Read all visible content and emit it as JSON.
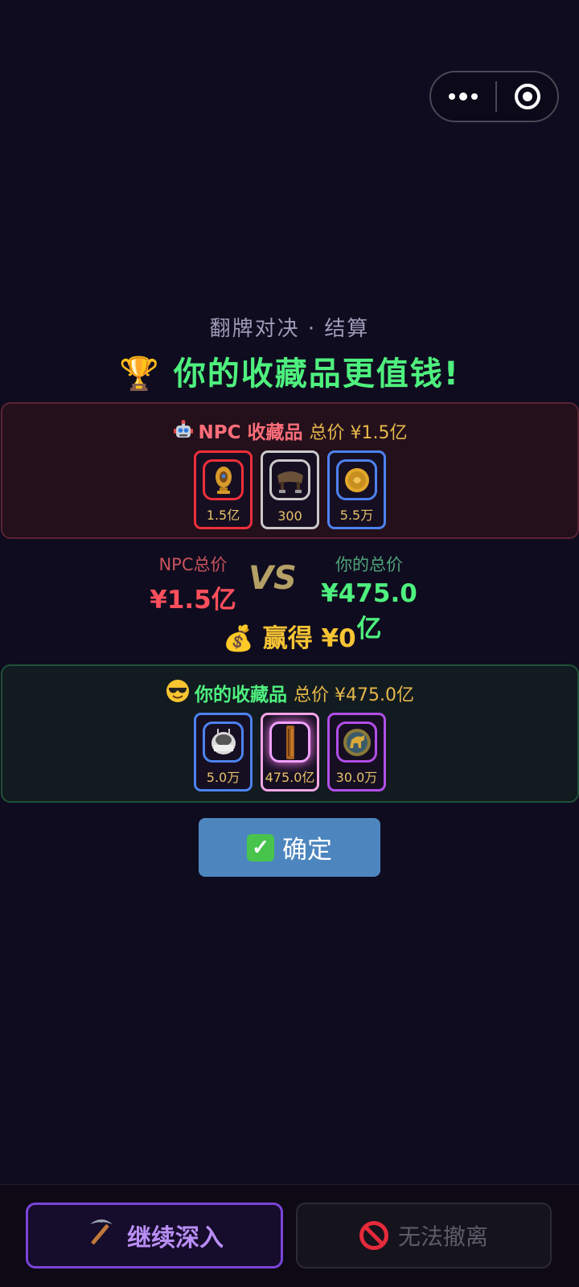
{
  "header": {
    "subtitle": "翻牌对决 · 结算",
    "headline_icon": "trophy-icon",
    "headline": "🏆 你的收藏品更值钱!"
  },
  "npc_panel": {
    "icon": "robot-icon",
    "title": "NPC 收藏品",
    "total": "总价 ¥1.5亿",
    "items": [
      {
        "icon": "golden-egg-icon",
        "value": "1.5亿",
        "rarity_color": "#ef2f3a"
      },
      {
        "icon": "saddle-icon",
        "value": "300",
        "rarity_color": "#c9c9c9"
      },
      {
        "icon": "gold-coin-icon",
        "value": "5.5万",
        "rarity_color": "#4d82f0"
      }
    ]
  },
  "versus": {
    "npc_label": "NPC总价",
    "npc_amount": "¥1.5亿",
    "vs": "VS",
    "you_label": "你的总价",
    "you_amount": "¥475.0亿"
  },
  "winnings": "💰 赢得 ¥0",
  "you_panel": {
    "icon": "sunglasses-face-icon",
    "title": "你的收藏品",
    "total": "总价 ¥475.0亿",
    "items": [
      {
        "icon": "silver-crown-icon",
        "value": "5.0万",
        "rarity_color": "#4d82f0"
      },
      {
        "icon": "bamboo-scroll-icon",
        "value": "475.0亿",
        "rarity_color": "#f2a6e6"
      },
      {
        "icon": "bronze-horse-icon",
        "value": "30.0万",
        "rarity_color": "#b24ee8"
      }
    ]
  },
  "confirm_button": {
    "label": "确定",
    "icon": "check-mark-icon"
  },
  "bottom": {
    "continue_label": "继续深入",
    "continue_icon": "pickaxe-icon",
    "evacuate_label": "无法撤离",
    "evacuate_icon": "prohibited-icon"
  }
}
